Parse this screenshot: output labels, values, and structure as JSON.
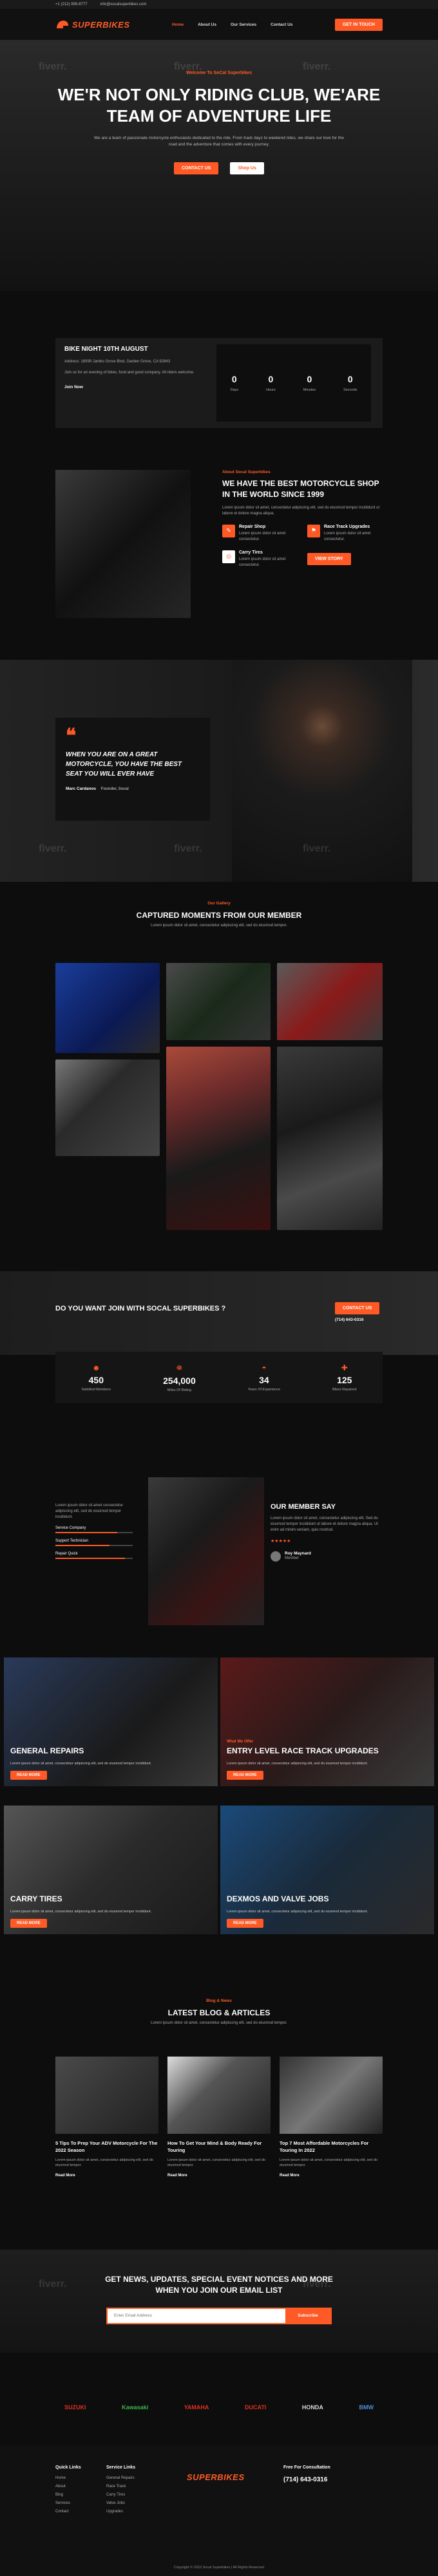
{
  "topbar": {
    "phone": "+1 (212) 999-8777",
    "email": "info@socalsuperbikes.com"
  },
  "header": {
    "logo_text": "SUPERBIKES",
    "nav": [
      "Home",
      "About Us",
      "Our Services",
      "Contact Us"
    ],
    "cta": "Get In Touch"
  },
  "hero": {
    "kicker": "Welcome To SoCal Superbikes",
    "title": "We'r Not Only Riding Club, We'are Team Of Adventure Life",
    "text": "We are a team of passionate motorcycle enthusiasts dedicated to the ride. From track days to weekend rides, we share our love for the road and the adventure that comes with every journey.",
    "btn_primary": "Contact Us",
    "btn_secondary": "Shop Us"
  },
  "event": {
    "title": "Bike Night 10th August",
    "address": "Address: 18099 Jambo Grove Blvd, Garden Grove, CA 92843",
    "details": "Join us for an evening of bikes, food and good company. All riders welcome.",
    "link": "Join Now",
    "counts": [
      {
        "num": "0",
        "label": "Days"
      },
      {
        "num": "0",
        "label": "Hours"
      },
      {
        "num": "0",
        "label": "Minutes"
      },
      {
        "num": "0",
        "label": "Seconds"
      }
    ]
  },
  "shop": {
    "kicker": "About Socal Superbikes",
    "title": "We Have The Best Motorcycle Shop In The World Since 1999",
    "text": "Lorem ipsum dolor sit amet, consectetur adipiscing elit, sed do eiusmod tempor incididunt ut labore et dolore magna aliqua.",
    "services": [
      {
        "name": "Repair Shop",
        "desc": "Lorem ipsum dolor sit amet consectetur."
      },
      {
        "name": "Race Track Upgrades",
        "desc": "Lorem ipsum dolor sit amet consectetur."
      },
      {
        "name": "Carry Tires",
        "desc": "Lorem ipsum dolor sit amet consectetur."
      }
    ],
    "btn": "View Story"
  },
  "quote": {
    "text": "When You Are On A Great Motorcycle, You Have The Best Seat You Will Ever Have",
    "author": "Marc Cardanos",
    "author_role": "Founder, Socal"
  },
  "gallery": {
    "kicker": "Our Gallery",
    "title": "Captured Moments From Our Member",
    "sub": "Lorem ipsum dolor sit amet, consectetur adipiscing elit, sed do eiusmod tempor."
  },
  "join": {
    "title": "Do You Want Join With Socal Superbikes ?",
    "btn": "Contact Us",
    "call": "(714) 643-0316"
  },
  "stats": [
    {
      "num": "450",
      "label": "Satisfied Members"
    },
    {
      "num": "254,000",
      "label": "Miles Of Riding"
    },
    {
      "num": "34",
      "label": "Years Of Experience"
    },
    {
      "num": "125",
      "label": "Bikes Repaired"
    }
  ],
  "testimonial": {
    "intro": "Lorem ipsum dolor sit amet consectetur adipiscing elit, sed do eiusmod tempor incididunt.",
    "bars": [
      {
        "name": "Service Company",
        "value": 0.8
      },
      {
        "name": "Support Technician",
        "value": 0.7
      },
      {
        "name": "Repair Quick",
        "value": 0.9
      }
    ],
    "title": "Our Member Say",
    "text": "Lorem ipsum dolor sit amet, consectetur adipiscing elit. Sed do eiusmod tempor incididunt ut labore et dolore magna aliqua. Ut enim ad minim veniam, quis nostrud.",
    "reviewer": "Roy Maynard",
    "reviewer_role": "Member"
  },
  "services": [
    {
      "kicker": "",
      "title": "General Repairs",
      "caption": "Lorem ipsum dolor sit amet, consectetur adipiscing elit, sed do eiusmod tempor incididunt.",
      "btn": "Read More"
    },
    {
      "kicker": "What We Offer",
      "title": "Entry Level Race Track Upgrades",
      "caption": "Lorem ipsum dolor sit amet, consectetur adipiscing elit, sed do eiusmod tempor incididunt.",
      "btn": "Read More"
    },
    {
      "kicker": "",
      "title": "Carry Tires",
      "caption": "Lorem ipsum dolor sit amet, consectetur adipiscing elit, sed do eiusmod tempor incididunt.",
      "btn": "Read More"
    },
    {
      "kicker": "",
      "title": "Dexmos And Valve Jobs",
      "caption": "Lorem ipsum dolor sit amet, consectetur adipiscing elit, sed do eiusmod tempor incididunt.",
      "btn": "Read More"
    }
  ],
  "blog": {
    "kicker": "Blog & News",
    "title": "Latest Blog & Articles",
    "sub": "Lorem ipsum dolor sit amet, consectetur adipiscing elit, sed do eiusmod tempor.",
    "posts": [
      {
        "title": "5 Tips To Prep Your ADV Motorcycle For The 2022 Season",
        "desc": "Lorem ipsum dolor sit amet, consectetur adipiscing elit, sed do eiusmod tempor.",
        "more": "Read More"
      },
      {
        "title": "How To Get Your Mind & Body Ready For Touring",
        "desc": "Lorem ipsum dolor sit amet, consectetur adipiscing elit, sed do eiusmod tempor.",
        "more": "Read More"
      },
      {
        "title": "Top 7 Most Affordable Motorcycles For Touring In 2022",
        "desc": "Lorem ipsum dolor sit amet, consectetur adipiscing elit, sed do eiusmod tempor.",
        "more": "Read More"
      }
    ]
  },
  "newsletter": {
    "title": "Get News, Updates, Special Event Notices And More When You Join Our Email List",
    "placeholder": "Enter Email Address",
    "btn": "Subscribe"
  },
  "brands": [
    "SUZUKI",
    "Kawasaki",
    "YAMAHA",
    "DUCATI",
    "HONDA",
    "BMW"
  ],
  "footer": {
    "quick_title": "Quick Links",
    "quick": [
      "Home",
      "About",
      "Blog",
      "Services",
      "Contact"
    ],
    "service_title": "Service Links",
    "service": [
      "General Repairs",
      "Race Track",
      "Carry Tires",
      "Valve Jobs",
      "Upgrades"
    ],
    "consult_title": "Free For Consultation",
    "phone": "(714) 643-0316",
    "copyright": "Copyright © 2022 Socal Superbikes | All Rights Reserved"
  },
  "watermark": "fiverr."
}
